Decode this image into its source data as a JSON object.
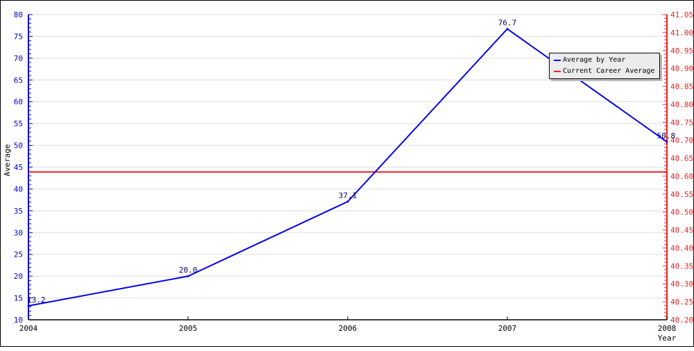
{
  "chart_data": {
    "type": "line",
    "title": "",
    "xlabel": "Year",
    "ylabel": "Average",
    "x": [
      "2004",
      "2005",
      "2006",
      "2007",
      "2008"
    ],
    "ylim": [
      10,
      80
    ],
    "y_ticks": [
      10,
      15,
      20,
      25,
      30,
      35,
      40,
      45,
      50,
      55,
      60,
      65,
      70,
      75,
      80
    ],
    "y2lim": [
      40.2,
      41.05
    ],
    "y2_ticks": [
      "40.20",
      "40.25",
      "40.30",
      "40.35",
      "40.40",
      "40.45",
      "40.50",
      "40.55",
      "40.60",
      "40.65",
      "40.70",
      "40.75",
      "40.80",
      "40.85",
      "40.90",
      "40.95",
      "41.00",
      "41.05"
    ],
    "grid": true,
    "legend_position": "top-right",
    "series": [
      {
        "name": "Average by Year",
        "axis": "left",
        "color": "#0000ee",
        "values": [
          13.2,
          20.0,
          37.1,
          76.7,
          50.8
        ],
        "labels": [
          "13.2",
          "20.0",
          "37.1",
          "76.7",
          "50.8"
        ]
      },
      {
        "name": "Current Career Average",
        "axis": "left",
        "color": "#ee2222",
        "constant": 43.9
      }
    ],
    "colors": {
      "left_axis": "#0000cc",
      "right_axis": "#ee2222",
      "grid": "#dddddd"
    }
  }
}
